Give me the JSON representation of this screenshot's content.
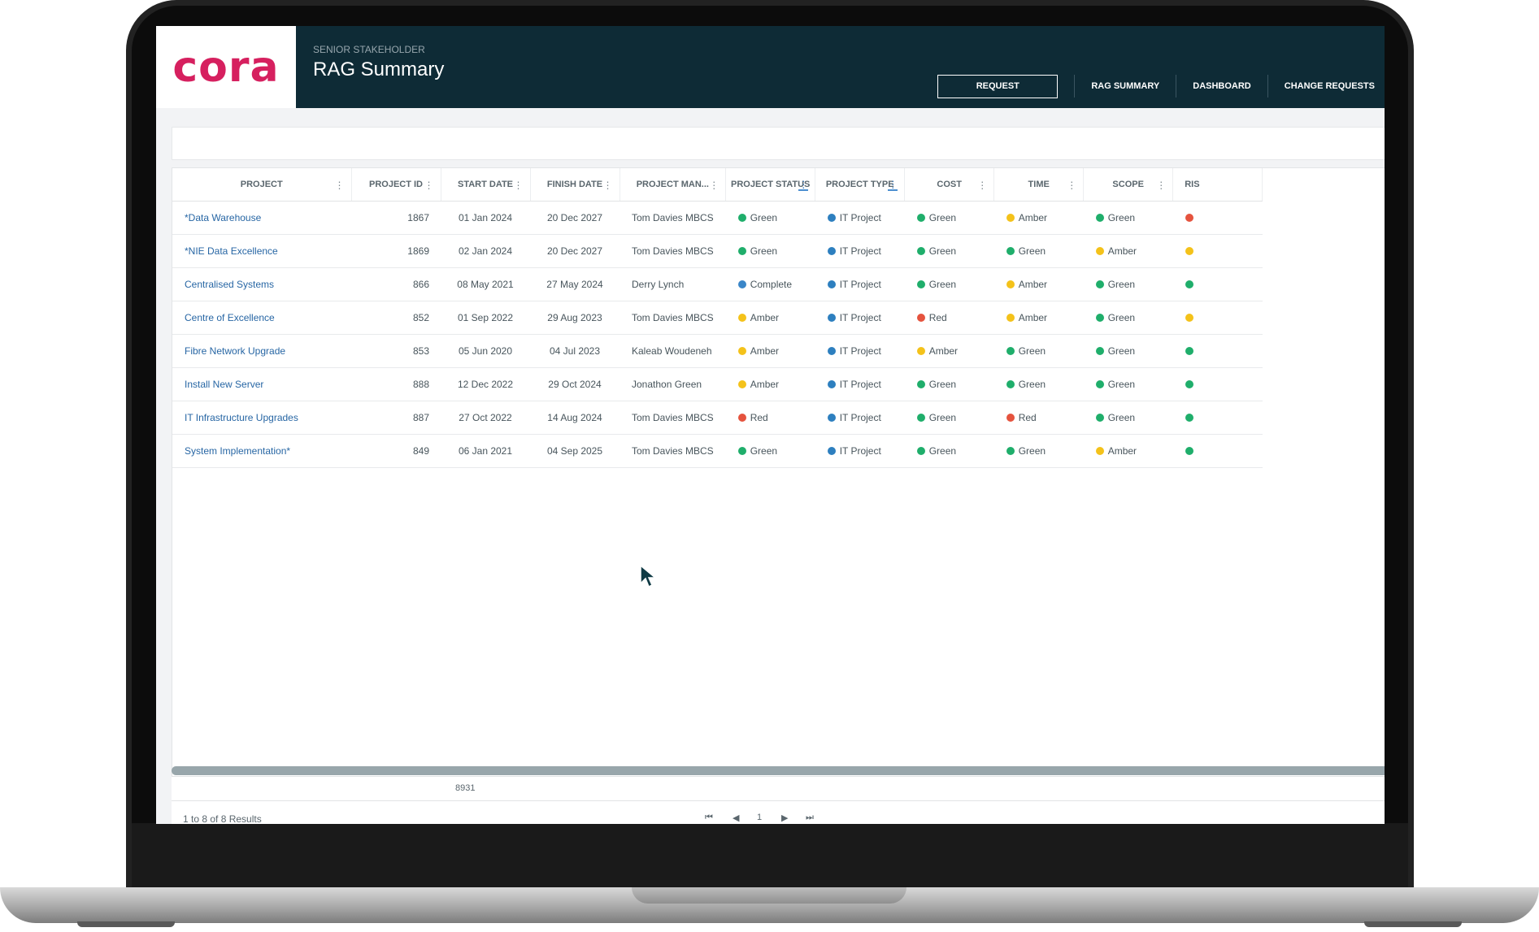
{
  "header": {
    "logo": "cora",
    "subtitle": "SENIOR STAKEHOLDER",
    "title": "RAG Summary",
    "nav": [
      "REQUEST",
      "RAG SUMMARY",
      "DASHBOARD",
      "CHANGE REQUESTS"
    ]
  },
  "colors": {
    "Green": "#1fae6b",
    "Amber": "#f4c21a",
    "Red": "#e5533e",
    "Complete": "#3a86c8",
    "IT Project": "#2d7fbf",
    "brand": "#d6205f",
    "header_bg": "#0e2b36"
  },
  "table": {
    "columns": [
      "PROJECT",
      "PROJECT ID",
      "START DATE",
      "FINISH DATE",
      "PROJECT MAN...",
      "PROJECT STATUS",
      "PROJECT TYPE",
      "COST",
      "TIME",
      "SCOPE",
      "RIS"
    ],
    "rows": [
      {
        "project": "*Data Warehouse",
        "id": "1867",
        "start": "01 Jan 2024",
        "finish": "20 Dec 2027",
        "manager": "Tom Davies MBCS",
        "status": "Green",
        "type": "IT Project",
        "cost": "Green",
        "time": "Amber",
        "scope": "Green",
        "risk": "Red"
      },
      {
        "project": "*NIE Data Excellence",
        "id": "1869",
        "start": "02 Jan 2024",
        "finish": "20 Dec 2027",
        "manager": "Tom Davies MBCS",
        "status": "Green",
        "type": "IT Project",
        "cost": "Green",
        "time": "Green",
        "scope": "Amber",
        "risk": "Amber"
      },
      {
        "project": "Centralised Systems",
        "id": "866",
        "start": "08 May 2021",
        "finish": "27 May 2024",
        "manager": "Derry Lynch",
        "status": "Complete",
        "type": "IT Project",
        "cost": "Green",
        "time": "Amber",
        "scope": "Green",
        "risk": "Green"
      },
      {
        "project": "Centre of Excellence",
        "id": "852",
        "start": "01 Sep 2022",
        "finish": "29 Aug 2023",
        "manager": "Tom Davies MBCS",
        "status": "Amber",
        "type": "IT Project",
        "cost": "Red",
        "time": "Amber",
        "scope": "Green",
        "risk": "Amber"
      },
      {
        "project": "Fibre Network Upgrade",
        "id": "853",
        "start": "05 Jun 2020",
        "finish": "04 Jul 2023",
        "manager": "Kaleab Woudeneh",
        "status": "Amber",
        "type": "IT Project",
        "cost": "Amber",
        "time": "Green",
        "scope": "Green",
        "risk": "Green"
      },
      {
        "project": "Install New Server",
        "id": "888",
        "start": "12 Dec 2022",
        "finish": "29 Oct 2024",
        "manager": "Jonathon Green",
        "status": "Amber",
        "type": "IT Project",
        "cost": "Green",
        "time": "Green",
        "scope": "Green",
        "risk": "Green"
      },
      {
        "project": "IT Infrastructure Upgrades",
        "id": "887",
        "start": "27 Oct 2022",
        "finish": "14 Aug 2024",
        "manager": "Tom Davies MBCS",
        "status": "Red",
        "type": "IT Project",
        "cost": "Green",
        "time": "Red",
        "scope": "Green",
        "risk": "Green"
      },
      {
        "project": "System Implementation*",
        "id": "849",
        "start": "06 Jan 2021",
        "finish": "04 Sep 2025",
        "manager": "Tom Davies MBCS",
        "status": "Green",
        "type": "IT Project",
        "cost": "Green",
        "time": "Green",
        "scope": "Amber",
        "risk": "Green"
      }
    ]
  },
  "footer": {
    "id_total": "8931",
    "results": "1 to 8 of 8 Results",
    "current_page": "1"
  },
  "icons": {
    "first": "first-page-icon",
    "prev": "prev-page-icon",
    "next": "next-page-icon",
    "last": "last-page-icon",
    "column_menu": "column-menu-icon",
    "cursor": "mouse-cursor-icon"
  }
}
